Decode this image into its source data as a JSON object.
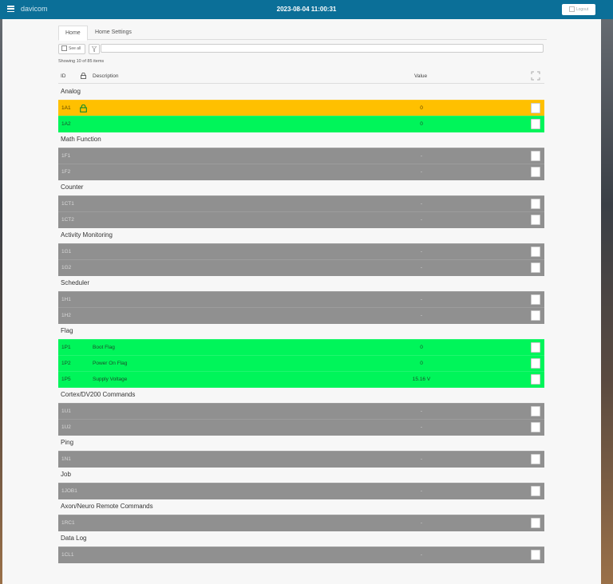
{
  "header": {
    "logo": "davicom",
    "datetime": "2023-08-04 11:00:31",
    "logout_label": "Logout"
  },
  "tabs": [
    {
      "label": "Home"
    },
    {
      "label": "Home Settings"
    }
  ],
  "toolbar": {
    "see_all_label": "See all",
    "search_value": ""
  },
  "showing_text": "Showing 10 of 85 items",
  "columns": {
    "id": "ID",
    "description": "Description",
    "value": "Value"
  },
  "groups": [
    {
      "title": "Analog",
      "rows": [
        {
          "id": "1A1",
          "desc": "",
          "value": "0",
          "status": "amber",
          "locked": true
        },
        {
          "id": "1A2",
          "desc": "",
          "value": "0",
          "status": "green",
          "locked": false
        }
      ]
    },
    {
      "title": "Math Function",
      "rows": [
        {
          "id": "1F1",
          "desc": "",
          "value": "-",
          "status": "grey",
          "locked": false
        },
        {
          "id": "1F2",
          "desc": "",
          "value": "-",
          "status": "grey",
          "locked": false
        }
      ]
    },
    {
      "title": "Counter",
      "rows": [
        {
          "id": "1CT1",
          "desc": "",
          "value": "-",
          "status": "grey",
          "locked": false
        },
        {
          "id": "1CT2",
          "desc": "",
          "value": "-",
          "status": "grey",
          "locked": false
        }
      ]
    },
    {
      "title": "Activity Monitoring",
      "rows": [
        {
          "id": "1G1",
          "desc": "",
          "value": "-",
          "status": "grey",
          "locked": false
        },
        {
          "id": "1G2",
          "desc": "",
          "value": "-",
          "status": "grey",
          "locked": false
        }
      ]
    },
    {
      "title": "Scheduler",
      "rows": [
        {
          "id": "1H1",
          "desc": "",
          "value": "-",
          "status": "grey",
          "locked": false
        },
        {
          "id": "1H2",
          "desc": "",
          "value": "-",
          "status": "grey",
          "locked": false
        }
      ]
    },
    {
      "title": "Flag",
      "rows": [
        {
          "id": "1P1",
          "desc": "Boot Flag",
          "value": "0",
          "status": "green",
          "locked": false
        },
        {
          "id": "1P2",
          "desc": "Power On Flag",
          "value": "0",
          "status": "green",
          "locked": false
        },
        {
          "id": "1P5",
          "desc": "Supply Voltage",
          "value": "15.16 V",
          "status": "green",
          "locked": false
        }
      ]
    },
    {
      "title": "Cortex/DV200 Commands",
      "rows": [
        {
          "id": "1U1",
          "desc": "",
          "value": "-",
          "status": "grey",
          "locked": false
        },
        {
          "id": "1U2",
          "desc": "",
          "value": "-",
          "status": "grey",
          "locked": false
        }
      ]
    },
    {
      "title": "Ping",
      "rows": [
        {
          "id": "1N1",
          "desc": "",
          "value": "-",
          "status": "grey",
          "locked": false
        }
      ]
    },
    {
      "title": "Job",
      "rows": [
        {
          "id": "1JOB1",
          "desc": "",
          "value": "-",
          "status": "grey",
          "locked": false
        }
      ]
    },
    {
      "title": "Axon/Neuro Remote Commands",
      "rows": [
        {
          "id": "1RC1",
          "desc": "",
          "value": "-",
          "status": "grey",
          "locked": false
        }
      ]
    },
    {
      "title": "Data Log",
      "rows": [
        {
          "id": "1CL1",
          "desc": "",
          "value": "-",
          "status": "grey",
          "locked": false
        }
      ]
    }
  ],
  "colors": {
    "topbar": "#0b6f98",
    "grey_row": "#909090",
    "green_row": "#00f55a",
    "amber_row": "#ffc000"
  }
}
